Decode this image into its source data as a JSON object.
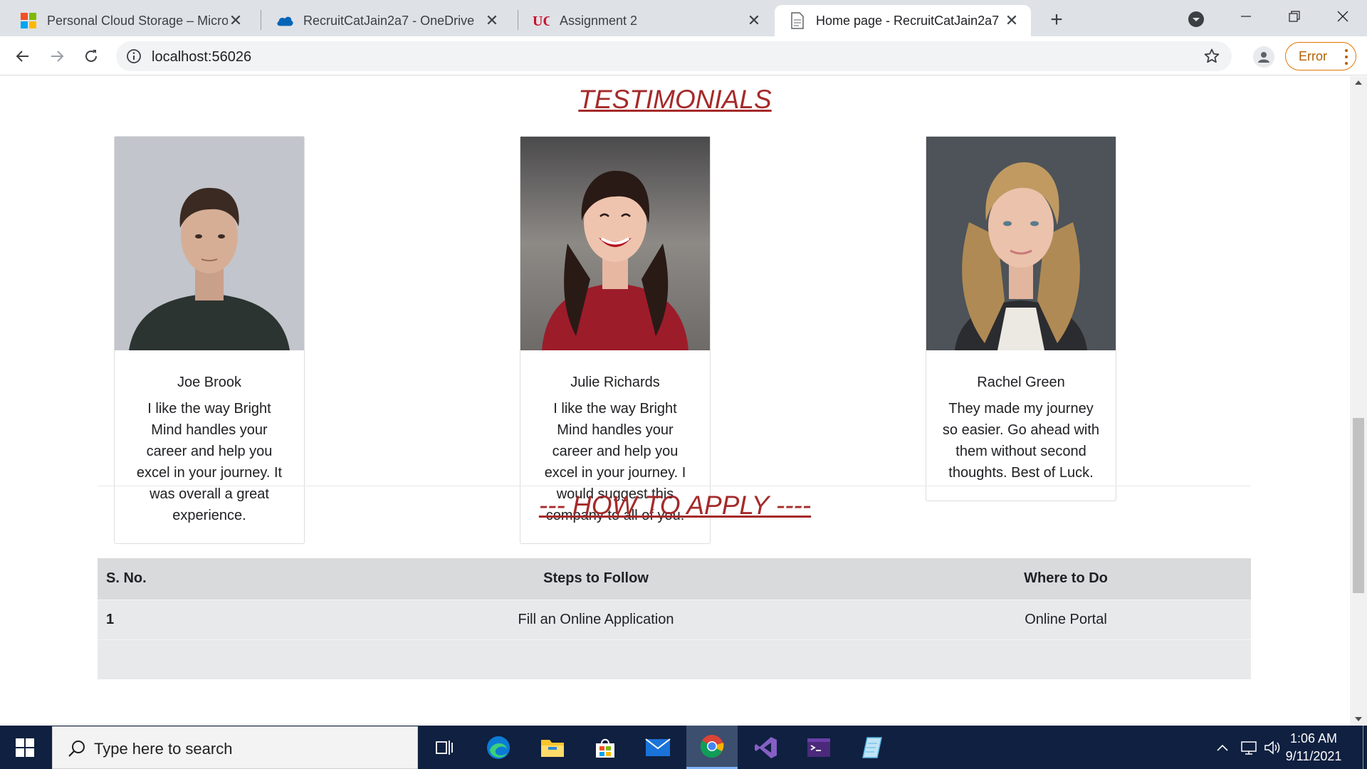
{
  "browser": {
    "tabs": [
      {
        "title": "Personal Cloud Storage – Microsoft",
        "icon": "microsoft-logo-icon"
      },
      {
        "title": "RecruitCatJain2a7 - OneDrive",
        "icon": "onedrive-cloud-icon"
      },
      {
        "title": "Assignment 2",
        "icon": "uc-logo-icon"
      },
      {
        "title": "Home page - RecruitCatJain2a7",
        "icon": "document-icon",
        "active": true
      }
    ],
    "address": "localhost:56026",
    "error_label": "Error"
  },
  "page": {
    "testimonials_title": "TESTIMONIALS",
    "testimonials": [
      {
        "name": "Joe Brook",
        "quote": "I like the way Bright Mind handles your career and help you excel in your journey. It was overall a great experience."
      },
      {
        "name": "Julie Richards",
        "quote": "I like the way Bright Mind handles your career and help you excel in your journey. I would suggest this company to all of you."
      },
      {
        "name": "Rachel Green",
        "quote": "They made my journey so easier. Go ahead with them without second thoughts. Best of Luck."
      }
    ],
    "apply_title": "--- HOW TO APPLY ----",
    "table": {
      "headers": [
        "S. No.",
        "Steps to Follow",
        "Where to Do"
      ],
      "rows": [
        [
          "1",
          "Fill an Online Application",
          "Online Portal"
        ]
      ]
    }
  },
  "taskbar": {
    "search_placeholder": "Type here to search",
    "time": "1:06 AM",
    "date": "9/11/2021"
  },
  "colors": {
    "heading": "#a52a2a",
    "taskbar": "#0f2040",
    "tabstrip": "#dee1e6"
  }
}
